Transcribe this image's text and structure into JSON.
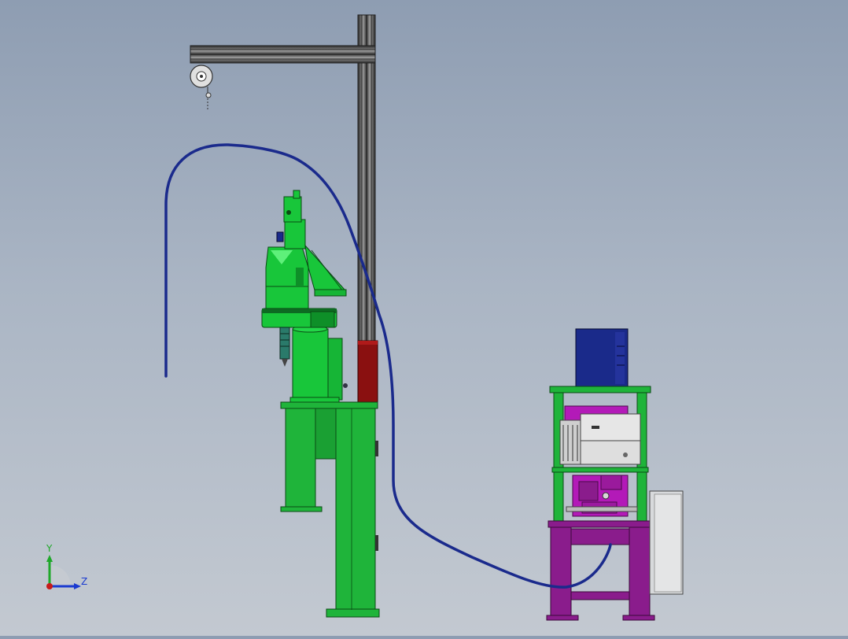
{
  "viewport": {
    "background_top": "#8e9db2",
    "background_bottom": "#c3c9d1"
  },
  "colors": {
    "robot": "#18c63a",
    "robot_dark": "#0e8f28",
    "cable": "#1a2a8c",
    "frame_green": "#1fb43a",
    "frame_purple": "#8a1c8c",
    "magenta": "#b31ab8",
    "controller_blue": "#1a2a8a",
    "column_red": "#8a1010",
    "gray_panel": "#d8dadc"
  },
  "triad": {
    "y_label": "Y",
    "z_label": "Z",
    "y_color": "#1fa82a",
    "z_color": "#1a3ad0",
    "x_color": "#c81a1a"
  },
  "parts": [
    {
      "name": "gantry-column",
      "icon": "aluminum-profile-icon"
    },
    {
      "name": "gantry-beam",
      "icon": "aluminum-profile-icon"
    },
    {
      "name": "cable-reel",
      "icon": "spring-balancer-icon"
    },
    {
      "name": "scara-robot",
      "icon": "robot-arm-icon"
    },
    {
      "name": "control-cabinet",
      "icon": "cabinet-icon"
    }
  ]
}
